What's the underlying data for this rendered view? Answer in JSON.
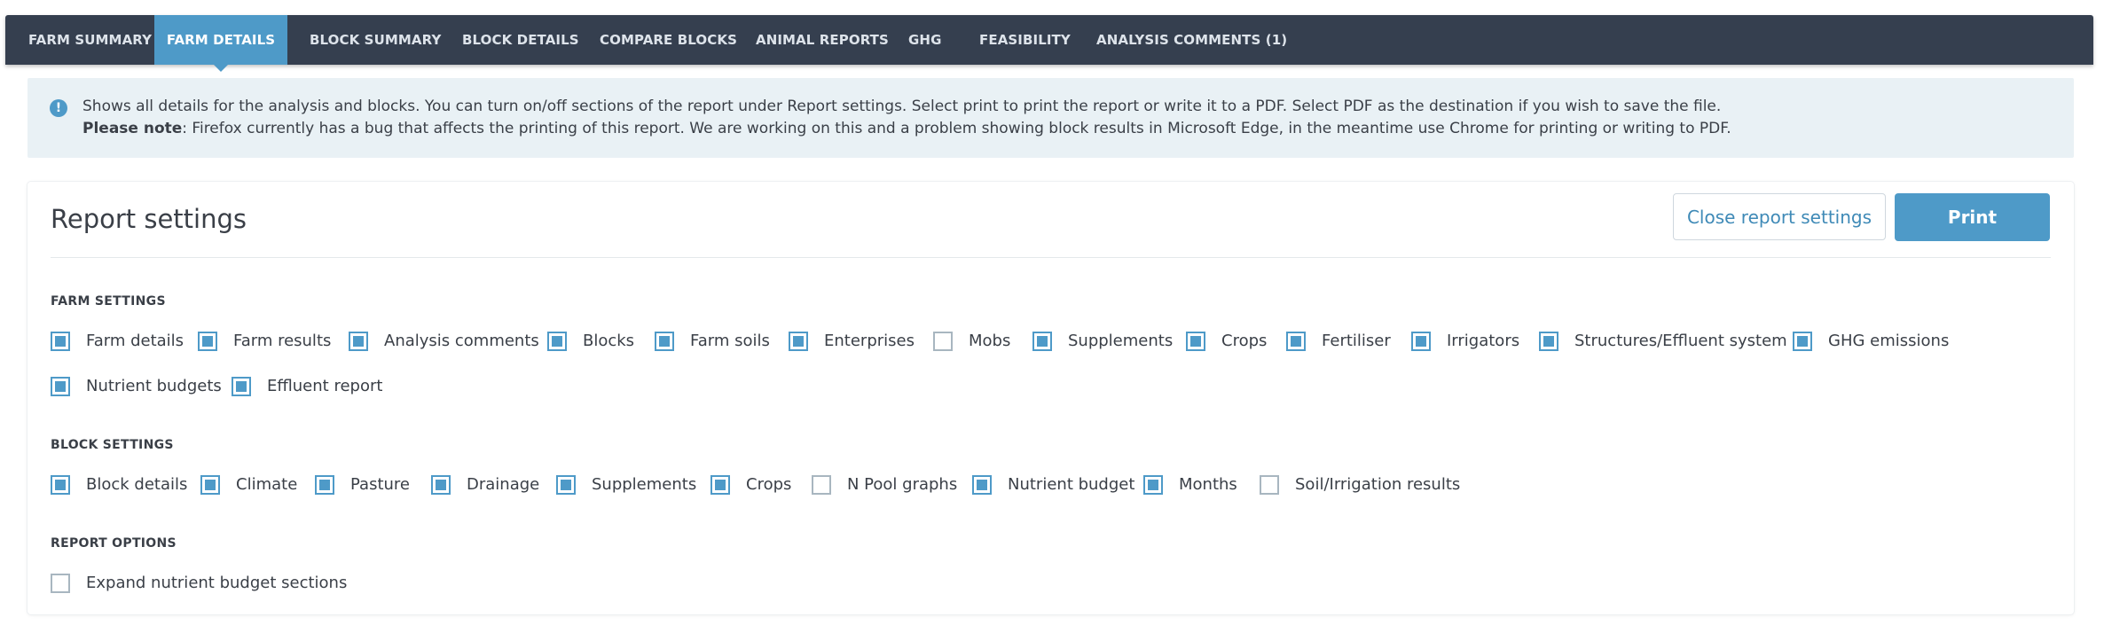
{
  "tabs": [
    {
      "label": "FARM SUMMARY",
      "active": false
    },
    {
      "label": "FARM DETAILS",
      "active": true
    },
    {
      "label": "BLOCK SUMMARY",
      "active": false
    },
    {
      "label": "BLOCK DETAILS",
      "active": false
    },
    {
      "label": "COMPARE BLOCKS",
      "active": false
    },
    {
      "label": "ANIMAL REPORTS",
      "active": false
    },
    {
      "label": "GHG",
      "active": false
    },
    {
      "label": "FEASIBILITY",
      "active": false
    },
    {
      "label": "ANALYSIS COMMENTS (1)",
      "active": false
    }
  ],
  "info": {
    "icon": "info-circle-icon",
    "line1": "Shows all details for the analysis and blocks. You can turn on/off sections of the report under Report settings. Select print to print the report or write it to a PDF. Select PDF as the destination if you wish to save the file.",
    "note_label": "Please note",
    "note_text": ": Firefox currently has a bug that affects the printing of this report. We are working on this and a problem showing block results in Microsoft Edge, in the meantime use Chrome for printing or writing to PDF."
  },
  "report_settings": {
    "title": "Report settings",
    "close_label": "Close report settings",
    "print_label": "Print"
  },
  "farm_settings": {
    "heading": "FARM SETTINGS",
    "options": [
      {
        "label": "Farm details",
        "checked": true
      },
      {
        "label": "Farm results",
        "checked": true
      },
      {
        "label": "Analysis comments",
        "checked": true
      },
      {
        "label": "Blocks",
        "checked": true
      },
      {
        "label": "Farm soils",
        "checked": true
      },
      {
        "label": "Enterprises",
        "checked": true
      },
      {
        "label": "Mobs",
        "checked": false
      },
      {
        "label": "Supplements",
        "checked": true
      },
      {
        "label": "Crops",
        "checked": true
      },
      {
        "label": "Fertiliser",
        "checked": true
      },
      {
        "label": "Irrigators",
        "checked": true
      },
      {
        "label": "Structures/Effluent system",
        "checked": true
      },
      {
        "label": "GHG emissions",
        "checked": true
      },
      {
        "label": "Nutrient budgets",
        "checked": true
      },
      {
        "label": "Effluent report",
        "checked": true
      }
    ]
  },
  "block_settings": {
    "heading": "BLOCK SETTINGS",
    "options": [
      {
        "label": "Block details",
        "checked": true
      },
      {
        "label": "Climate",
        "checked": true
      },
      {
        "label": "Pasture",
        "checked": true
      },
      {
        "label": "Drainage",
        "checked": true
      },
      {
        "label": "Supplements",
        "checked": true
      },
      {
        "label": "Crops",
        "checked": true
      },
      {
        "label": "N Pool graphs",
        "checked": false
      },
      {
        "label": "Nutrient budget",
        "checked": true
      },
      {
        "label": "Months",
        "checked": true
      },
      {
        "label": "Soil/Irrigation results",
        "checked": false
      }
    ]
  },
  "report_options": {
    "heading": "REPORT OPTIONS",
    "options": [
      {
        "label": "Expand nutrient budget sections",
        "checked": false
      }
    ]
  }
}
